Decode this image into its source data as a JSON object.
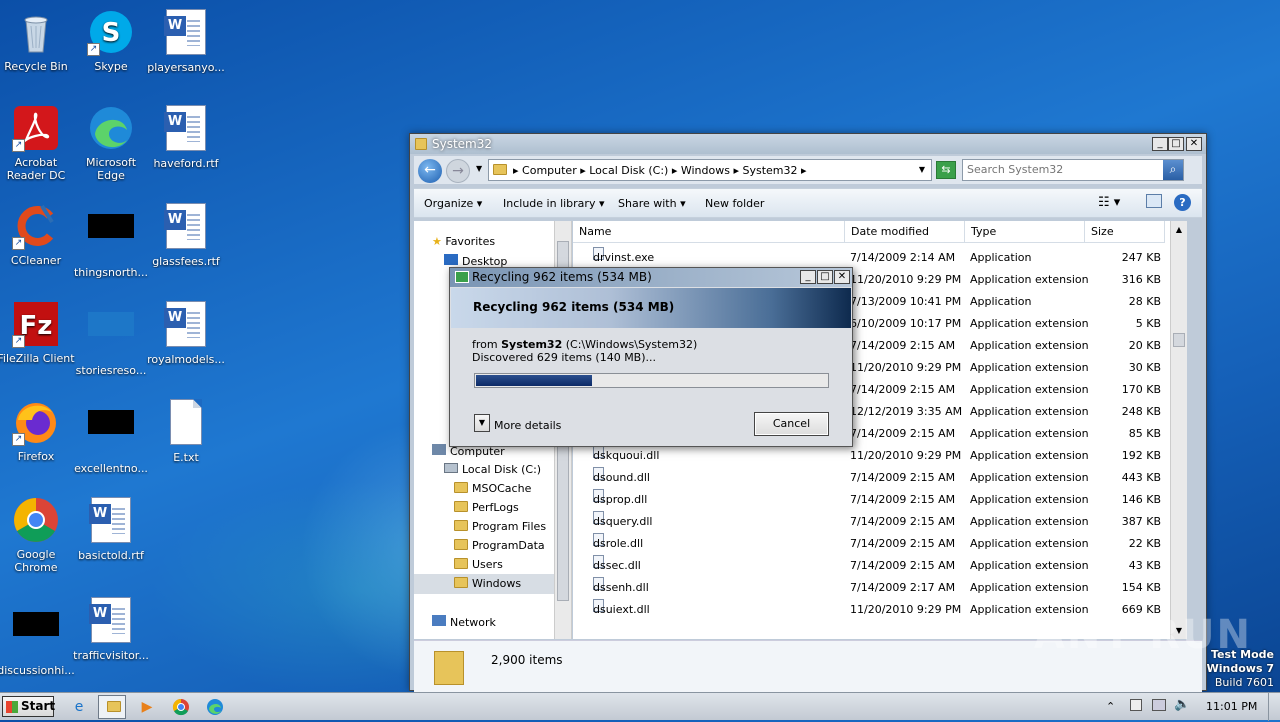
{
  "desktop": {
    "icons": [
      {
        "label": "Recycle Bin",
        "icon": "recycle-bin-icon"
      },
      {
        "label": "Skype",
        "icon": "skype-icon"
      },
      {
        "label": "playersanyo...",
        "icon": "word-doc-icon"
      },
      {
        "label": "Acrobat Reader DC",
        "icon": "acrobat-icon"
      },
      {
        "label": "Microsoft Edge",
        "icon": "edge-icon"
      },
      {
        "label": "haveford.rtf",
        "icon": "word-doc-icon"
      },
      {
        "label": "CCleaner",
        "icon": "ccleaner-icon"
      },
      {
        "label": "thingsnorth...",
        "icon": "black-thumbnail"
      },
      {
        "label": "glassfees.rtf",
        "icon": "word-doc-icon"
      },
      {
        "label": "FileZilla Client",
        "icon": "filezilla-icon"
      },
      {
        "label": "storiesreso...",
        "icon": "blue-thumbnail"
      },
      {
        "label": "royalmodels...",
        "icon": "word-doc-icon"
      },
      {
        "label": "Firefox",
        "icon": "firefox-icon"
      },
      {
        "label": "excellentno...",
        "icon": "black-thumbnail"
      },
      {
        "label": "E.txt",
        "icon": "text-file-icon"
      },
      {
        "label": "Google Chrome",
        "icon": "chrome-icon"
      },
      {
        "label": "basictold.rtf",
        "icon": "word-doc-icon"
      },
      {
        "label": "discussionhi...",
        "icon": "black-thumbnail"
      },
      {
        "label": "trafficvisitor...",
        "icon": "word-doc-icon"
      }
    ]
  },
  "explorer": {
    "title": "System32",
    "breadcrumb": [
      "Computer",
      "Local Disk (C:)",
      "Windows",
      "System32"
    ],
    "search_placeholder": "Search System32",
    "toolbar": {
      "organize": "Organize",
      "include": "Include in library",
      "share": "Share with",
      "new_folder": "New folder"
    },
    "nav": {
      "favorites": "Favorites",
      "desktop": "Desktop",
      "computer": "Computer",
      "local_disk": "Local Disk (C:)",
      "folders": [
        "MSOCache",
        "PerfLogs",
        "Program Files",
        "ProgramData",
        "Users",
        "Windows"
      ],
      "network": "Network"
    },
    "columns": {
      "name": "Name",
      "date": "Date modified",
      "type": "Type",
      "size": "Size"
    },
    "rows": [
      {
        "name": "drvinst.exe",
        "date": "7/14/2009 2:14 AM",
        "type": "Application",
        "size": "247 KB"
      },
      {
        "name": "",
        "date": "11/20/2010 9:29 PM",
        "type": "Application extension",
        "size": "316 KB"
      },
      {
        "name": "",
        "date": "7/13/2009 10:41 PM",
        "type": "Application",
        "size": "28 KB"
      },
      {
        "name": "",
        "date": "6/10/2009 10:17 PM",
        "type": "Application extension",
        "size": "5 KB"
      },
      {
        "name": "",
        "date": "7/14/2009 2:15 AM",
        "type": "Application extension",
        "size": "20 KB"
      },
      {
        "name": "",
        "date": "11/20/2010 9:29 PM",
        "type": "Application extension",
        "size": "30 KB"
      },
      {
        "name": "",
        "date": "7/14/2009 2:15 AM",
        "type": "Application extension",
        "size": "170 KB"
      },
      {
        "name": "",
        "date": "12/12/2019 3:35 AM",
        "type": "Application extension",
        "size": "248 KB"
      },
      {
        "name": "",
        "date": "7/14/2009 2:15 AM",
        "type": "Application extension",
        "size": "85 KB"
      },
      {
        "name": "dskquoui.dll",
        "date": "11/20/2010 9:29 PM",
        "type": "Application extension",
        "size": "192 KB"
      },
      {
        "name": "dsound.dll",
        "date": "7/14/2009 2:15 AM",
        "type": "Application extension",
        "size": "443 KB"
      },
      {
        "name": "dsprop.dll",
        "date": "7/14/2009 2:15 AM",
        "type": "Application extension",
        "size": "146 KB"
      },
      {
        "name": "dsquery.dll",
        "date": "7/14/2009 2:15 AM",
        "type": "Application extension",
        "size": "387 KB"
      },
      {
        "name": "dsrole.dll",
        "date": "7/14/2009 2:15 AM",
        "type": "Application extension",
        "size": "22 KB"
      },
      {
        "name": "dssec.dll",
        "date": "7/14/2009 2:15 AM",
        "type": "Application extension",
        "size": "43 KB"
      },
      {
        "name": "dssenh.dll",
        "date": "7/14/2009 2:17 AM",
        "type": "Application extension",
        "size": "154 KB"
      },
      {
        "name": "dsuiext.dll",
        "date": "11/20/2010 9:29 PM",
        "type": "Application extension",
        "size": "669 KB"
      }
    ],
    "status": "2,900 items"
  },
  "dialog": {
    "title": "Recycling 962 items (534 MB)",
    "heading": "Recycling 962 items (534 MB)",
    "from_label": "from",
    "from_folder": "System32",
    "from_path": "(C:\\Windows\\System32)",
    "discovered": "Discovered 629 items (140 MB)...",
    "progress": 0.33,
    "more_details": "More details",
    "cancel": "Cancel"
  },
  "taskbar": {
    "start": "Start",
    "clock": "11:01 PM"
  },
  "watermark": "ANY RUN",
  "os": {
    "line1": "Test Mode",
    "line2": "Windows 7",
    "line3": "Build 7601"
  }
}
